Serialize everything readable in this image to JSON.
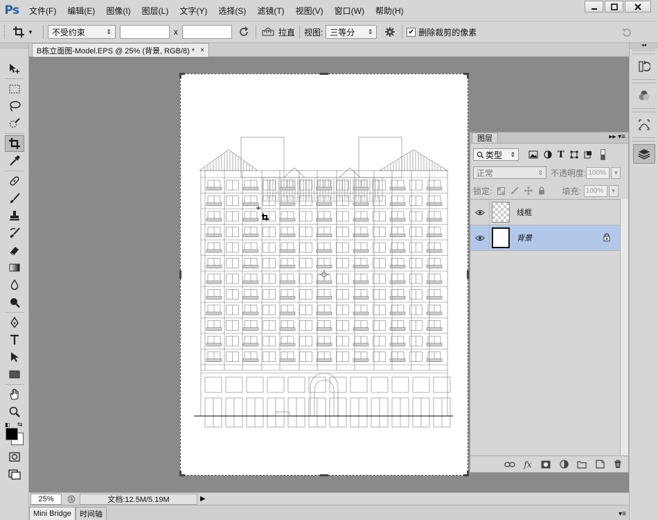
{
  "app": {
    "logo": "Ps",
    "menu": [
      "文件(F)",
      "编辑(E)",
      "图像(I)",
      "图层(L)",
      "文字(Y)",
      "选择(S)",
      "滤镜(T)",
      "视图(V)",
      "窗口(W)",
      "帮助(H)"
    ],
    "window_controls": {
      "minimize": "minimize-icon",
      "maximize": "maximize-icon",
      "close": "close-icon"
    }
  },
  "options_bar": {
    "tool_icon": "crop-icon",
    "constraint_select": "不受约束",
    "width_value": "",
    "height_value": "",
    "x_label": "x",
    "straighten_label": "拉直",
    "view_label": "视图:",
    "view_select": "三等分",
    "delete_cropped_label": "删除裁剪的像素",
    "delete_cropped_checked": true
  },
  "document": {
    "tab_title": "B栋立面图-Model.EPS @ 25% (背景, RGB/8) *",
    "close_glyph": "×"
  },
  "status": {
    "zoom": "25%",
    "doc_info": "文档:12.5M/5.19M"
  },
  "bottom_tabs": [
    "Mini Bridge",
    "时间轴"
  ],
  "layers_panel": {
    "tab_label": "图层",
    "filter_label": "类型",
    "blend_mode": "正常",
    "opacity_label": "不透明度:",
    "opacity_value": "100%",
    "lock_label": "锁定:",
    "fill_label": "填充:",
    "fill_value": "100%",
    "layers": [
      {
        "name": "线框",
        "visible": true,
        "selected": false,
        "locked": false,
        "italic": false
      },
      {
        "name": "背景",
        "visible": true,
        "selected": true,
        "locked": true,
        "italic": true
      }
    ],
    "footer_icons": [
      "link-icon",
      "fx-icon",
      "mask-icon",
      "adjustment-icon",
      "group-icon",
      "new-layer-icon",
      "delete-icon"
    ]
  },
  "colors": {
    "ui_bg": "#d6d6d6",
    "canvas_bg": "#8a8a8a",
    "selection": "#b2c7ea",
    "ps_blue": "#2b5fa8"
  }
}
